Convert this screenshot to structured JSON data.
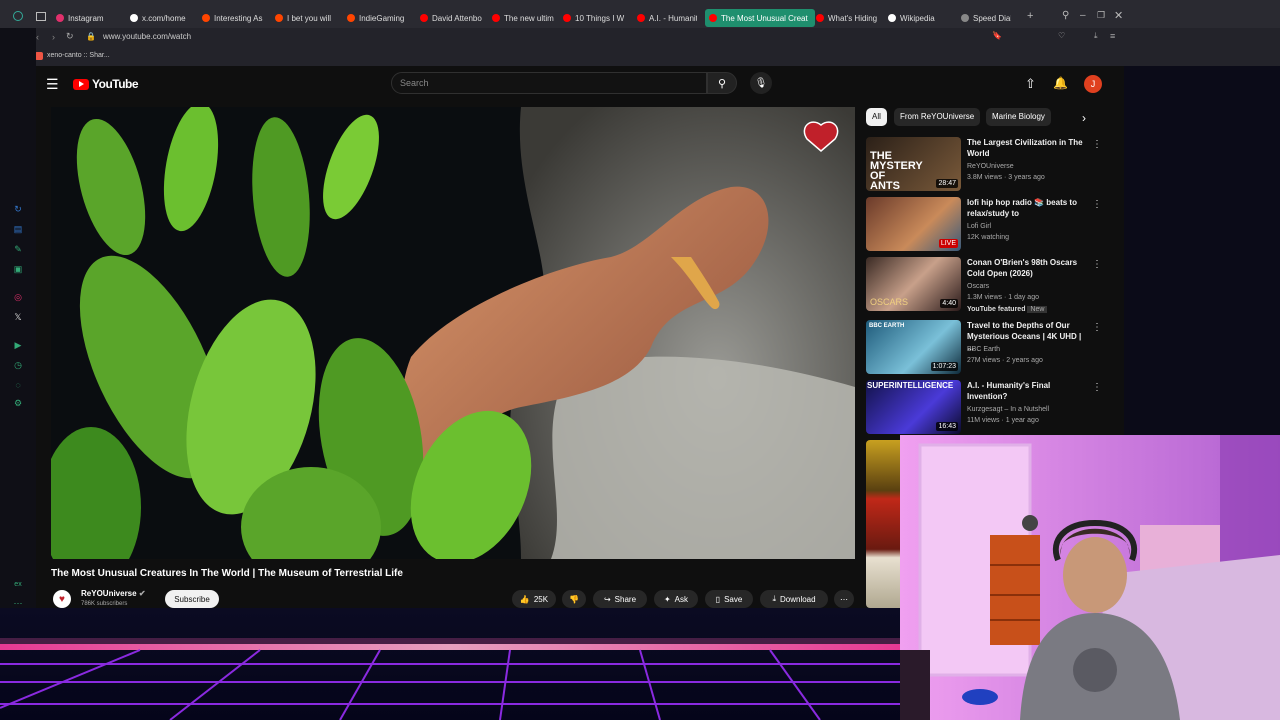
{
  "browser": {
    "tabs": [
      {
        "label": "Instagram",
        "color": "#e1306c"
      },
      {
        "label": "x.com/home",
        "color": "#ffffff"
      },
      {
        "label": "Interesting As",
        "color": "#ff4500"
      },
      {
        "label": "I bet you will",
        "color": "#ff4500"
      },
      {
        "label": "IndieGaming",
        "color": "#ff4500"
      },
      {
        "label": "David Attenbo",
        "color": "#ff0000"
      },
      {
        "label": "The new ultim",
        "color": "#ff0000"
      },
      {
        "label": "10 Things I W",
        "color": "#ff0000"
      },
      {
        "label": "A.I. - Humanit",
        "color": "#ff0000"
      },
      {
        "label": "The Most Unusual Creat",
        "color": "#ff0000"
      },
      {
        "label": "What's Hiding",
        "color": "#ff0000"
      },
      {
        "label": "Wikipedia",
        "color": "#ffffff"
      },
      {
        "label": "Speed Dial",
        "color": "#888888"
      }
    ],
    "url": "www.youtube.com/watch",
    "bookmark": "xeno-canto :: Shar..."
  },
  "youtube": {
    "logo": "YouTube",
    "search_placeholder": "Search",
    "avatar_letter": "J",
    "chips": [
      "All",
      "From ReYOUniverse",
      "Marine Biology"
    ],
    "video_title": "The Most Unusual Creatures In The World | The Museum of Terrestrial Life",
    "channel_name": "ReYOUniverse",
    "subscribers": "786K subscribers",
    "subscribe_label": "Subscribe",
    "likes": "25K",
    "share_label": "Share",
    "ask_label": "Ask",
    "save_label": "Save",
    "download_label": "Download",
    "recommendations": [
      {
        "title": "The Largest Civilization in The World",
        "channel": "ReYOUniverse",
        "meta": "3.8M views · 3 years ago",
        "duration": "28:47",
        "thumb_text": "THE MYSTERY OF ANTS"
      },
      {
        "title": "lofi hip hop radio 📚 beats to relax/study to",
        "channel": "Lofi Girl",
        "meta": "12K watching",
        "duration": "LIVE",
        "thumb_text": ""
      },
      {
        "title": "Conan O'Brien's 98th Oscars Cold Open (2026)",
        "channel": "Oscars",
        "meta": "1.3M views · 1 day ago",
        "extra": "YouTube featured",
        "badge": "New",
        "duration": "4:40",
        "thumb_text": "OSCARS"
      },
      {
        "title": "Travel to the Depths of Our Mysterious Oceans | 4K UHD | ...",
        "channel": "BBC Earth",
        "meta": "27M views · 2 years ago",
        "duration": "1:07:23",
        "thumb_text": "BBC EARTH"
      },
      {
        "title": "A.I. - Humanity's Final Invention?",
        "channel": "Kurzgesagt – In a Nutshell",
        "meta": "11M views · 1 year ago",
        "duration": "16:43",
        "thumb_text": "SUPERINTELLIGENCE"
      }
    ]
  }
}
